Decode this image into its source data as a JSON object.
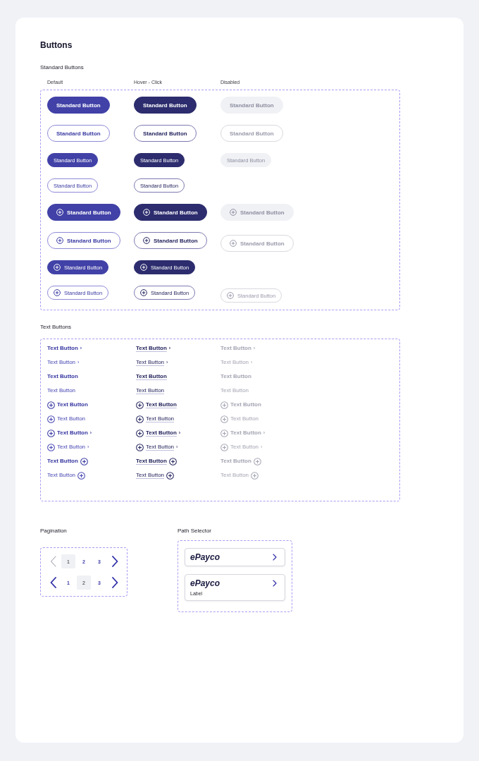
{
  "page": {
    "title": "Buttons"
  },
  "standard_buttons": {
    "title": "Standard Buttons",
    "columns": [
      "Default",
      "Hover - Click",
      "Disabled"
    ],
    "rows": [
      {
        "kind": "filled",
        "buttons": [
          {
            "label": "Standard Button",
            "hovered": false,
            "disabled": false
          },
          {
            "label": "Standard Button",
            "hovered": true,
            "disabled": false
          },
          {
            "label": "Standard Button",
            "hovered": false,
            "disabled": true
          }
        ]
      },
      {
        "kind": "outline",
        "buttons": [
          {
            "label": "Standard Button",
            "hovered": false,
            "disabled": false
          },
          {
            "label": "Standard Button",
            "hovered": true,
            "disabled": false
          },
          {
            "label": "Standard Button",
            "hovered": false,
            "disabled": true
          }
        ]
      },
      {
        "kind": "filled-compact",
        "buttons": [
          {
            "label": "Standard Button",
            "hovered": false,
            "disabled": false
          },
          {
            "label": "Standard Button",
            "hovered": true,
            "disabled": false
          },
          {
            "label": "Standard Button",
            "hovered": false,
            "disabled": true
          }
        ]
      },
      {
        "kind": "outline-compact",
        "buttons": [
          {
            "label": "Standard Button",
            "hovered": false,
            "disabled": false
          },
          {
            "label": "Standard Button",
            "hovered": true,
            "disabled": false
          }
        ]
      },
      {
        "kind": "filled-plus",
        "buttons": [
          {
            "label": "Standard Button",
            "hovered": false,
            "disabled": false
          },
          {
            "label": "Standard Button",
            "hovered": true,
            "disabled": false
          },
          {
            "label": "Standard Button",
            "hovered": false,
            "disabled": true
          }
        ]
      },
      {
        "kind": "outline-plus",
        "buttons": [
          {
            "label": "Standard Button",
            "hovered": false,
            "disabled": false
          },
          {
            "label": "Standard Button",
            "hovered": true,
            "disabled": false
          },
          {
            "label": "Standard Button",
            "hovered": false,
            "disabled": true
          }
        ]
      },
      {
        "kind": "filled-compact-plus",
        "buttons": [
          {
            "label": "Standard Button",
            "hovered": false,
            "disabled": false
          },
          {
            "label": "Standard Button",
            "hovered": true,
            "disabled": false
          }
        ]
      },
      {
        "kind": "outline-compact-plus",
        "buttons": [
          {
            "label": "Standard Button",
            "hovered": false,
            "disabled": false
          },
          {
            "label": "Standard Button",
            "hovered": true,
            "disabled": false
          },
          {
            "label": "Standard Button",
            "hovered": false,
            "disabled": true
          }
        ]
      }
    ]
  },
  "text_buttons": {
    "title": "Text Buttons",
    "rows": [
      {
        "kind": "strong",
        "buttons": [
          {
            "label": "Text Button",
            "chevron": "›",
            "hovered": false,
            "disabled": false
          },
          {
            "label": "Text Button",
            "chevron": "›",
            "hovered": true,
            "disabled": false
          },
          {
            "label": "Text Button",
            "chevron": "›",
            "hovered": false,
            "disabled": true
          }
        ]
      },
      {
        "kind": "plain",
        "buttons": [
          {
            "label": "Text Button",
            "chevron": "›",
            "hovered": false,
            "disabled": false
          },
          {
            "label": "Text Button",
            "chevron": "›",
            "hovered": true,
            "disabled": false
          },
          {
            "label": "Text Button",
            "chevron": "›",
            "hovered": false,
            "disabled": true
          }
        ]
      },
      {
        "kind": "strong",
        "buttons": [
          {
            "label": "Text Button",
            "hovered": false,
            "disabled": false
          },
          {
            "label": "Text Button",
            "hovered": true,
            "disabled": false
          },
          {
            "label": "Text Button",
            "hovered": false,
            "disabled": true
          }
        ]
      },
      {
        "kind": "plain",
        "buttons": [
          {
            "label": "Text Button",
            "hovered": false,
            "disabled": false
          },
          {
            "label": "Text Button",
            "hovered": true,
            "disabled": false
          },
          {
            "label": "Text Button",
            "hovered": false,
            "disabled": true
          }
        ]
      },
      {
        "kind": "strong-plus-left",
        "buttons": [
          {
            "label": "Text Button",
            "hovered": false,
            "disabled": false
          },
          {
            "label": "Text Button",
            "hovered": true,
            "disabled": false
          },
          {
            "label": "Text Button",
            "hovered": false,
            "disabled": true
          }
        ]
      },
      {
        "kind": "plain-plus-left",
        "buttons": [
          {
            "label": "Text Button",
            "hovered": false,
            "disabled": false
          },
          {
            "label": "Text Button",
            "hovered": true,
            "disabled": false
          },
          {
            "label": "Text Button",
            "hovered": false,
            "disabled": true
          }
        ]
      },
      {
        "kind": "strong-plus-left",
        "buttons": [
          {
            "label": "Text Button",
            "chevron": "›",
            "hovered": false,
            "disabled": false
          },
          {
            "label": "Text Button",
            "chevron": "›",
            "hovered": true,
            "disabled": false
          },
          {
            "label": "Text Button",
            "chevron": "›",
            "hovered": false,
            "disabled": true
          }
        ]
      },
      {
        "kind": "plain-plus-left",
        "buttons": [
          {
            "label": "Text Button",
            "chevron": "›",
            "hovered": false,
            "disabled": false
          },
          {
            "label": "Text Button",
            "chevron": "›",
            "hovered": true,
            "disabled": false
          },
          {
            "label": "Text Button",
            "chevron": "›",
            "hovered": false,
            "disabled": true
          }
        ]
      },
      {
        "kind": "strong-plus-right",
        "buttons": [
          {
            "label": "Text Button",
            "hovered": false,
            "disabled": false
          },
          {
            "label": "Text Button",
            "hovered": true,
            "disabled": false
          },
          {
            "label": "Text Button",
            "hovered": false,
            "disabled": true
          }
        ]
      },
      {
        "kind": "plain-plus-right",
        "buttons": [
          {
            "label": "Text Button",
            "hovered": false,
            "disabled": false
          },
          {
            "label": "Text Button",
            "hovered": true,
            "disabled": false
          },
          {
            "label": "Text Button",
            "hovered": false,
            "disabled": true
          }
        ]
      }
    ]
  },
  "pagination": {
    "title": "Pagination",
    "rows": [
      {
        "previous": {
          "disabled": true
        },
        "pages": [
          {
            "label": "1",
            "selected": true
          },
          {
            "label": "2",
            "selected": false
          },
          {
            "label": "3",
            "selected": false
          }
        ],
        "next": {
          "disabled": false
        }
      },
      {
        "previous": {
          "disabled": false
        },
        "pages": [
          {
            "label": "1",
            "selected": false
          },
          {
            "label": "2",
            "selected": true
          },
          {
            "label": "3",
            "selected": false
          }
        ],
        "next": {
          "disabled": false
        }
      }
    ]
  },
  "path_selector": {
    "title": "Path Selector",
    "options": [
      {
        "logo": "ePayco"
      },
      {
        "logo": "ePayco",
        "label": "Label"
      }
    ]
  }
}
